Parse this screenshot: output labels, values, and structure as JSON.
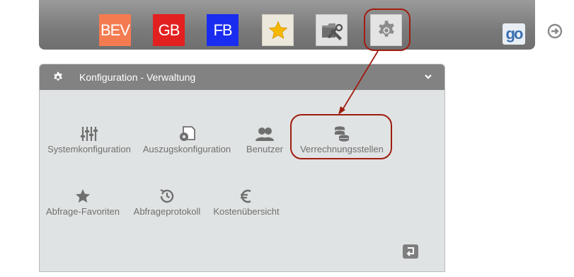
{
  "toolbar": {
    "buttons": [
      {
        "id": "bev",
        "label": "BEV",
        "color": "#f47b50"
      },
      {
        "id": "gb",
        "label": "GB",
        "color": "#e32020"
      },
      {
        "id": "fb",
        "label": "FB",
        "color": "#1a2cf0"
      },
      {
        "id": "favorites",
        "icon": "star-icon"
      },
      {
        "id": "tools",
        "icon": "folder-tools-icon"
      },
      {
        "id": "configuration",
        "icon": "gear-icon"
      }
    ],
    "logo_text": "go",
    "logout_icon": "logout-icon"
  },
  "panel": {
    "title": "Konfiguration - Verwaltung",
    "header_icon": "gear-icon",
    "collapse_icon": "chevron-down-icon",
    "items": [
      {
        "label": "Systemkonfiguration",
        "icon": "sliders-icon"
      },
      {
        "label": "Auszugskonfiguration",
        "icon": "document-gear-icon"
      },
      {
        "label": "Benutzer",
        "icon": "users-icon"
      },
      {
        "label": "Verrechnungsstellen",
        "icon": "coins-icon"
      },
      {
        "label": "Abfrage-Favoriten",
        "icon": "star-icon"
      },
      {
        "label": "Abfrageprotokoll",
        "icon": "clock-history-icon"
      },
      {
        "label": "Kostenübersicht",
        "icon": "euro-icon"
      }
    ],
    "back_icon": "return-icon"
  },
  "annotation": {
    "color": "#a01c10"
  }
}
